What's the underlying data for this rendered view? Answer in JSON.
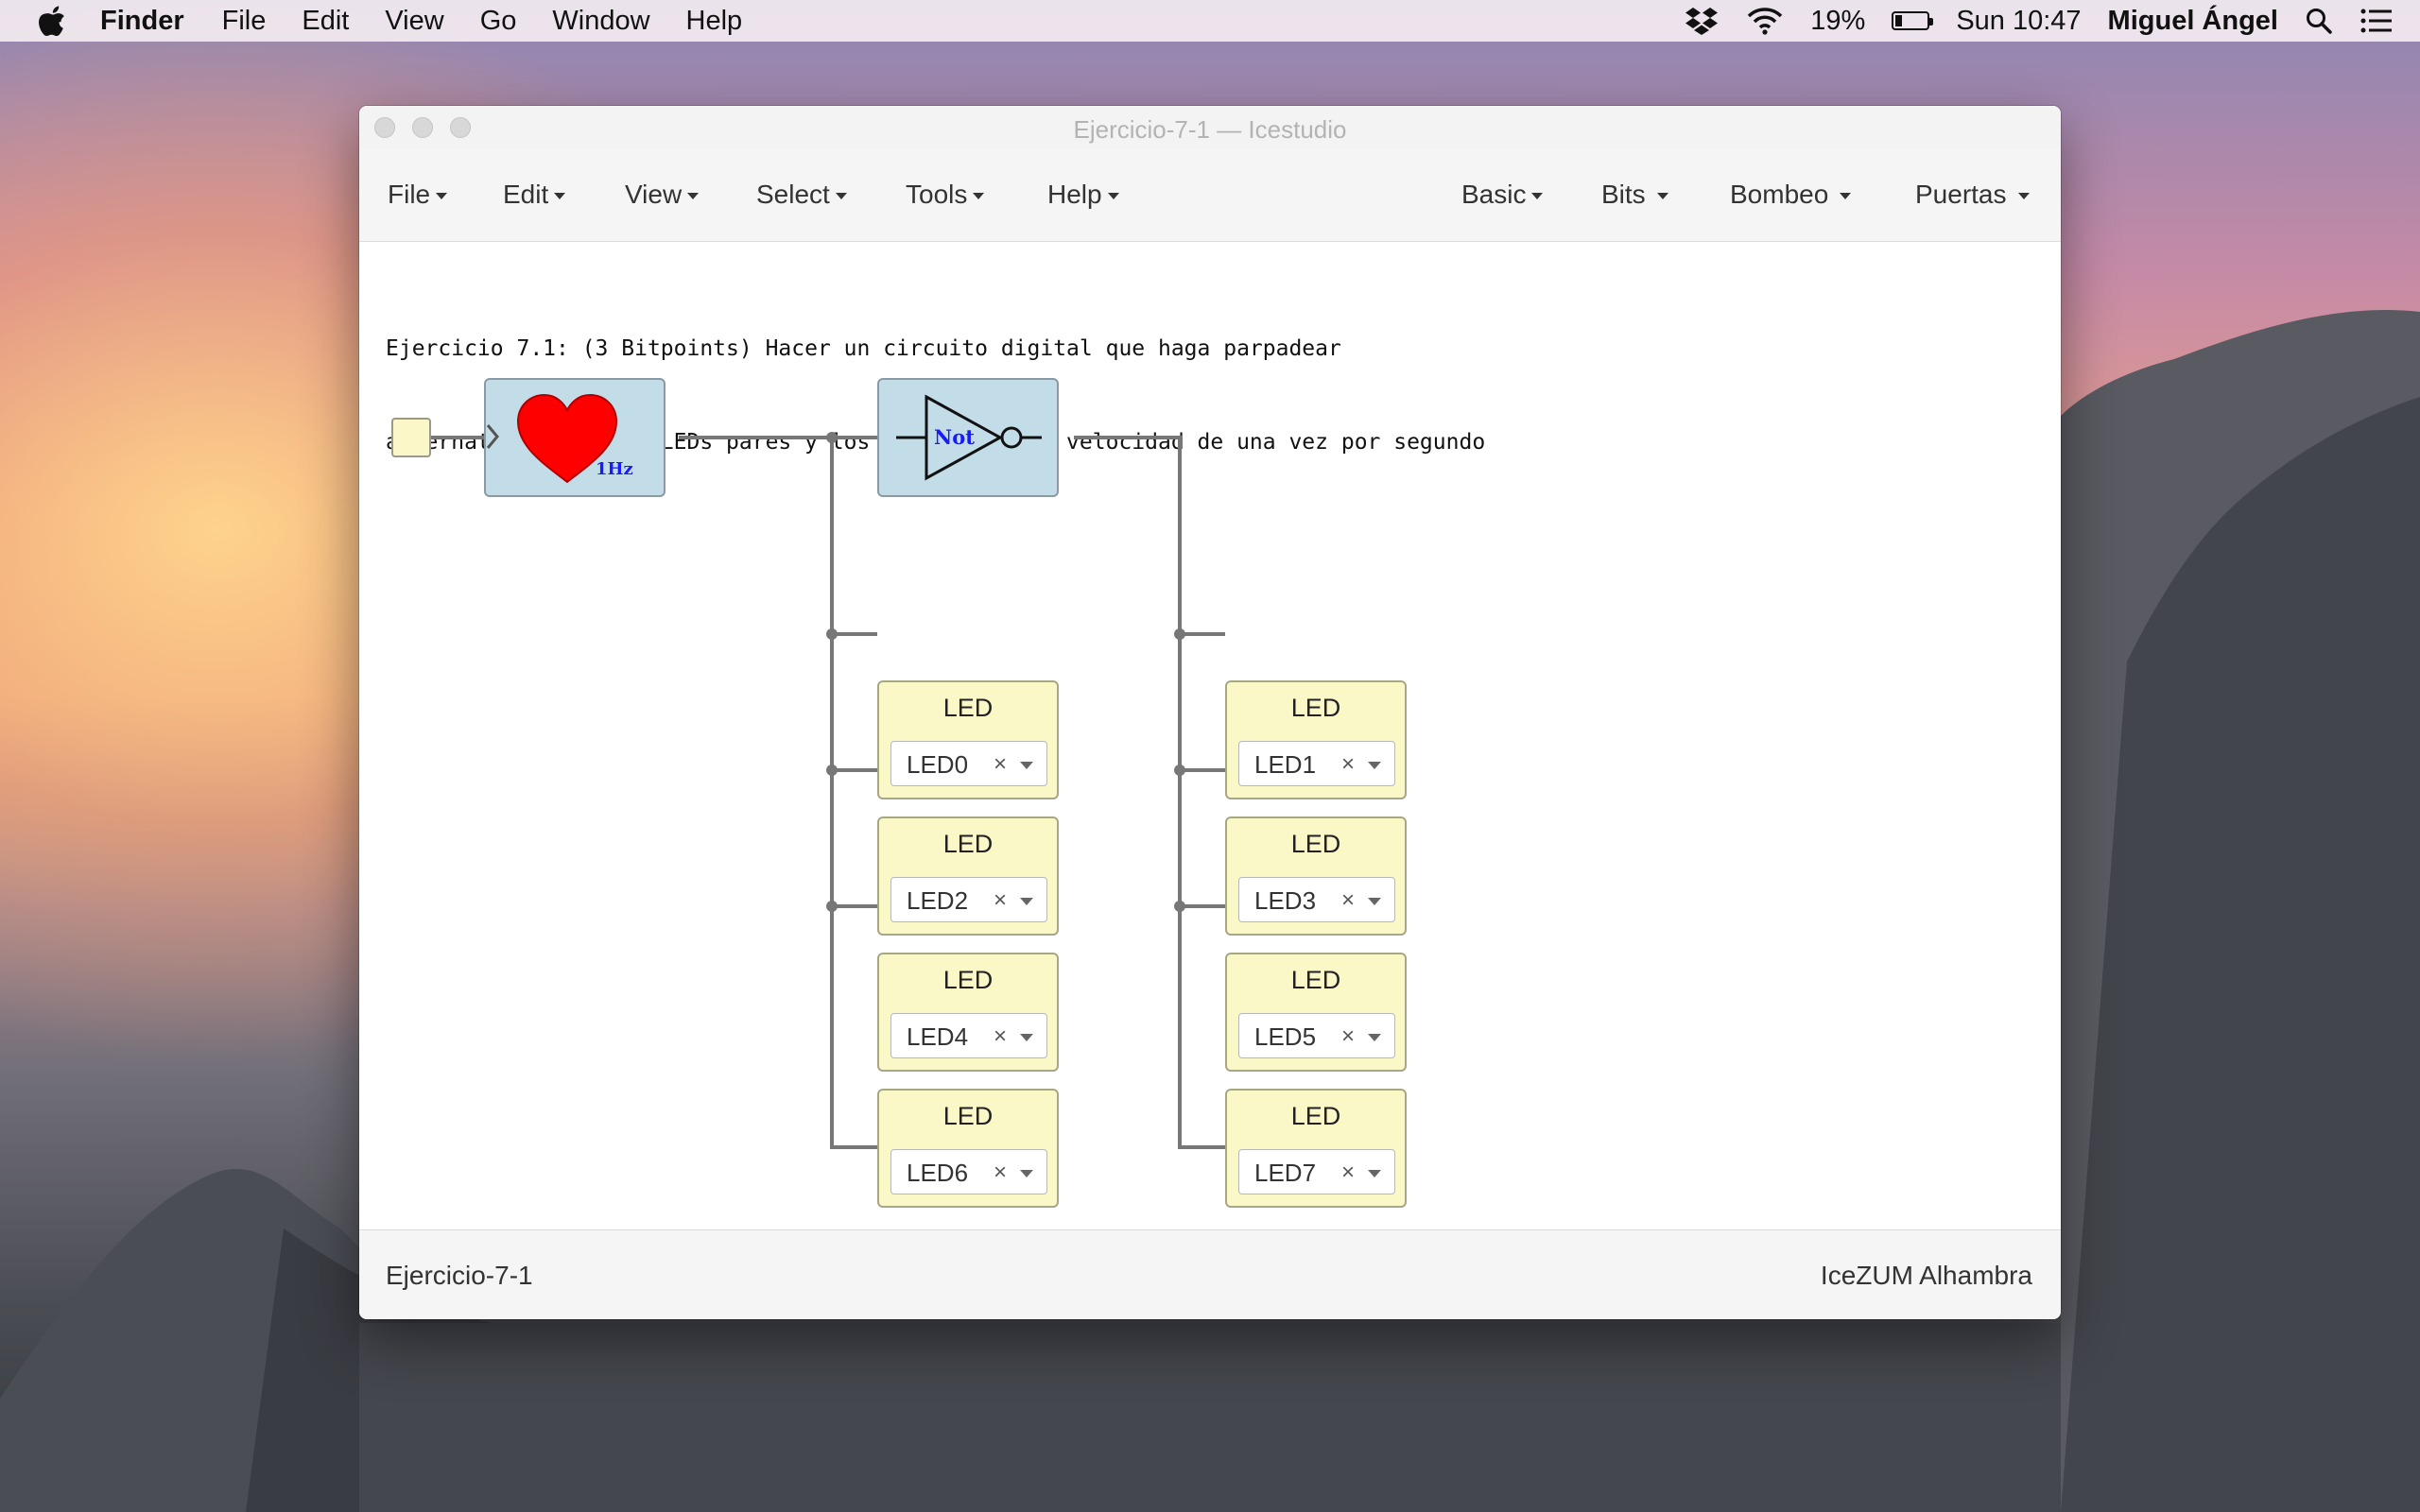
{
  "menubar": {
    "app_name": "Finder",
    "items": [
      "File",
      "Edit",
      "View",
      "Go",
      "Window",
      "Help"
    ],
    "battery": "19%",
    "battery_level": 0.19,
    "clock": "Sun 10:47",
    "user": "Miguel Ángel"
  },
  "window": {
    "title": "Ejercicio-7-1 — Icestudio",
    "menus_left": [
      "File",
      "Edit",
      "View",
      "Select",
      "Tools",
      "Help"
    ],
    "menus_right": [
      "Basic",
      "Bits",
      "Bombeo",
      "Puertas"
    ],
    "info_lines": [
      "Ejercicio 7.1: (3 Bitpoints) Hacer un circuito digital que haga parpadear",
      "alternativamente los LEDs pares y los impares a una velocidad de una vez por segundo"
    ],
    "blocks": {
      "heart_label": "1Hz",
      "not_label": "Not"
    },
    "leds_even": [
      {
        "title": "LED",
        "value": "LED0"
      },
      {
        "title": "LED",
        "value": "LED2"
      },
      {
        "title": "LED",
        "value": "LED4"
      },
      {
        "title": "LED",
        "value": "LED6"
      }
    ],
    "leds_odd": [
      {
        "title": "LED",
        "value": "LED1"
      },
      {
        "title": "LED",
        "value": "LED3"
      },
      {
        "title": "LED",
        "value": "LED5"
      },
      {
        "title": "LED",
        "value": "LED7"
      }
    ],
    "clear_glyph": "×",
    "status_left": "Ejercicio-7-1",
    "status_right": "IceZUM Alhambra"
  },
  "colors": {
    "block_blue": "#c3dde8",
    "led_yellow": "#fbf8c8",
    "wire": "#777777",
    "heart": "#ff0000",
    "label_blue": "#1a1aff"
  }
}
